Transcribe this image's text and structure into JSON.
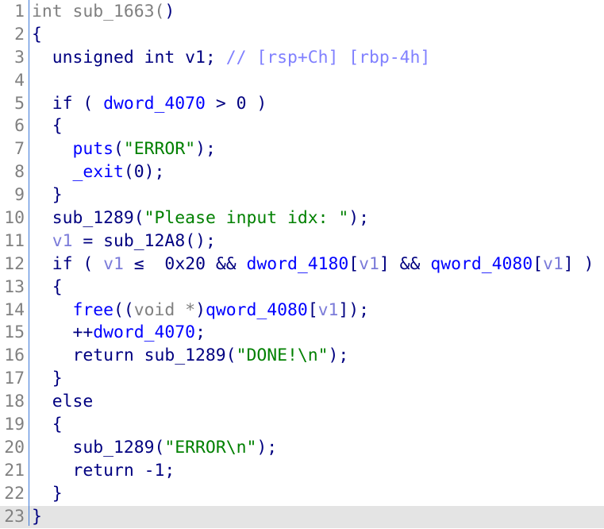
{
  "colors": {
    "keyword": "#000080",
    "global": "#0000ff",
    "variable": "#7b7bd9",
    "string": "#008000",
    "comment": "#8080ff",
    "cast": "#808080",
    "current_line": "#e4e4e4"
  },
  "current_line": 23,
  "lines": [
    {
      "n": "1",
      "tokens": [
        [
          "int sub_1663(",
          "gray"
        ],
        [
          ")",
          "plain"
        ]
      ]
    },
    {
      "n": "2",
      "tokens": [
        [
          "{",
          "plain"
        ]
      ]
    },
    {
      "n": "3",
      "tokens": [
        [
          "  unsigned int v1; ",
          "plain"
        ],
        [
          "// [rsp+Ch] [rbp-4h]",
          "cmt"
        ]
      ]
    },
    {
      "n": "4",
      "tokens": []
    },
    {
      "n": "5",
      "tokens": [
        [
          "  if ( ",
          "plain"
        ],
        [
          "dword_4070",
          "global"
        ],
        [
          " > 0 )",
          "plain"
        ]
      ]
    },
    {
      "n": "6",
      "tokens": [
        [
          "  {",
          "plain"
        ]
      ]
    },
    {
      "n": "7",
      "tokens": [
        [
          "    ",
          "plain"
        ],
        [
          "puts",
          "global"
        ],
        [
          "(",
          "plain"
        ],
        [
          "\"ERROR\"",
          "str"
        ],
        [
          ");",
          "plain"
        ]
      ]
    },
    {
      "n": "8",
      "tokens": [
        [
          "    ",
          "plain"
        ],
        [
          "_exit",
          "global"
        ],
        [
          "(0);",
          "plain"
        ]
      ]
    },
    {
      "n": "9",
      "tokens": [
        [
          "  }",
          "plain"
        ]
      ]
    },
    {
      "n": "10",
      "tokens": [
        [
          "  sub_1289(",
          "plain"
        ],
        [
          "\"Please input idx: \"",
          "str"
        ],
        [
          ");",
          "plain"
        ]
      ]
    },
    {
      "n": "11",
      "tokens": [
        [
          "  ",
          "plain"
        ],
        [
          "v1",
          "var"
        ],
        [
          " = sub_12A8();",
          "plain"
        ]
      ]
    },
    {
      "n": "12",
      "tokens": [
        [
          "  if ( ",
          "plain"
        ],
        [
          "v1",
          "var"
        ],
        [
          " ≤  0x20 && ",
          "plain"
        ],
        [
          "dword_4180",
          "global"
        ],
        [
          "[",
          "plain"
        ],
        [
          "v1",
          "var"
        ],
        [
          "] && ",
          "plain"
        ],
        [
          "qword_4080",
          "global"
        ],
        [
          "[",
          "plain"
        ],
        [
          "v1",
          "var"
        ],
        [
          "] )",
          "plain"
        ]
      ]
    },
    {
      "n": "13",
      "tokens": [
        [
          "  {",
          "plain"
        ]
      ]
    },
    {
      "n": "14",
      "tokens": [
        [
          "    ",
          "plain"
        ],
        [
          "free",
          "global"
        ],
        [
          "((",
          "plain"
        ],
        [
          "void *",
          "gray"
        ],
        [
          ")",
          "plain"
        ],
        [
          "qword_4080",
          "global"
        ],
        [
          "[",
          "plain"
        ],
        [
          "v1",
          "var"
        ],
        [
          "]);",
          "plain"
        ]
      ]
    },
    {
      "n": "15",
      "tokens": [
        [
          "    ++",
          "plain"
        ],
        [
          "dword_4070",
          "global"
        ],
        [
          ";",
          "plain"
        ]
      ]
    },
    {
      "n": "16",
      "tokens": [
        [
          "    return sub_1289(",
          "plain"
        ],
        [
          "\"DONE!\\n\"",
          "str"
        ],
        [
          ");",
          "plain"
        ]
      ]
    },
    {
      "n": "17",
      "tokens": [
        [
          "  }",
          "plain"
        ]
      ]
    },
    {
      "n": "18",
      "tokens": [
        [
          "  else",
          "plain"
        ]
      ]
    },
    {
      "n": "19",
      "tokens": [
        [
          "  {",
          "plain"
        ]
      ]
    },
    {
      "n": "20",
      "tokens": [
        [
          "    sub_1289(",
          "plain"
        ],
        [
          "\"ERROR\\n\"",
          "str"
        ],
        [
          ");",
          "plain"
        ]
      ]
    },
    {
      "n": "21",
      "tokens": [
        [
          "    return -1;",
          "plain"
        ]
      ]
    },
    {
      "n": "22",
      "tokens": [
        [
          "  }",
          "plain"
        ]
      ]
    },
    {
      "n": "23",
      "tokens": [
        [
          "}",
          "plain"
        ]
      ]
    }
  ]
}
